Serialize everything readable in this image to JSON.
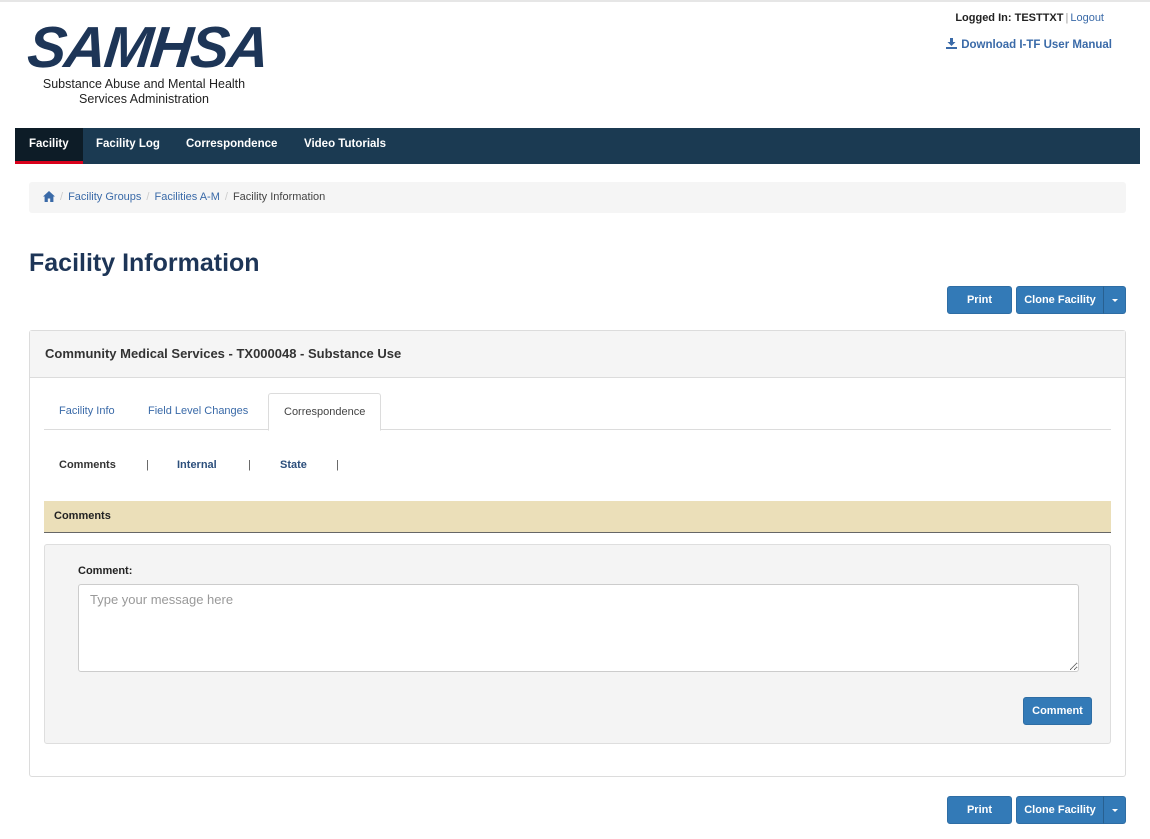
{
  "header": {
    "logo_text": "SAMHSA",
    "logo_subtitle_line1": "Substance Abuse and Mental Health",
    "logo_subtitle_line2": "Services Administration",
    "logged_in_label": "Logged In:",
    "username": "TESTTXT",
    "logout_label": "Logout",
    "download_label": "Download I-TF User Manual"
  },
  "nav": {
    "items": [
      {
        "label": "Facility"
      },
      {
        "label": "Facility Log"
      },
      {
        "label": "Correspondence"
      },
      {
        "label": "Video Tutorials"
      }
    ],
    "active_index": 0
  },
  "breadcrumb": {
    "items": [
      "Facility Groups",
      "Facilities A-M"
    ],
    "current": "Facility Information"
  },
  "page": {
    "title": "Facility Information"
  },
  "actions": {
    "print_label": "Print",
    "clone_label": "Clone Facility"
  },
  "panel": {
    "heading": "Community Medical Services - TX000048 - Substance Use",
    "tabs": [
      {
        "label": "Facility Info"
      },
      {
        "label": "Field Level Changes"
      },
      {
        "label": "Correspondence"
      }
    ],
    "active_tab_index": 2,
    "subnav": {
      "active": "Comments",
      "links": [
        "Internal",
        "State"
      ],
      "separator": "|"
    },
    "section_title": "Comments",
    "form": {
      "comment_label": "Comment:",
      "comment_value": "",
      "comment_placeholder": "Type your message here",
      "submit_label": "Comment"
    }
  },
  "colors": {
    "navbar": "#1b3a52",
    "nav_active": "#0d1c27",
    "nav_active_underline": "#d9001b",
    "primary_button": "#337ab7",
    "section_bar": "#ebdfb9",
    "link": "#3a6aa8",
    "title": "#1d3557"
  }
}
